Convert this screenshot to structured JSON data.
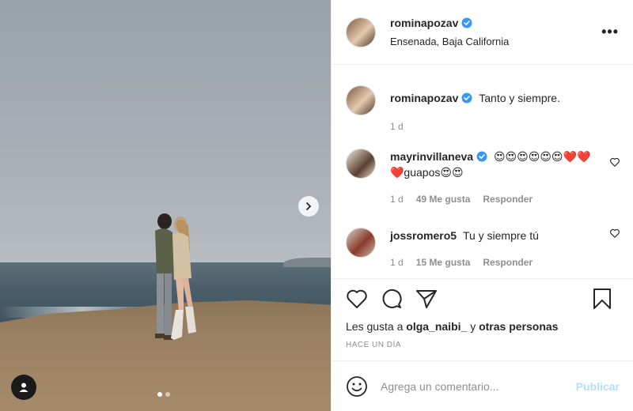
{
  "post": {
    "author": "rominapozav",
    "location": "Ensenada, Baja California",
    "more_icon": "more-horizontal-icon",
    "carousel_dots": 2,
    "carousel_active": 1
  },
  "caption": {
    "author": "rominapozav",
    "text": "Tanto y siempre.",
    "time": "1 d"
  },
  "comments": [
    {
      "author": "mayrinvillaneva",
      "text": "😍😍😍😍😍😍❤️❤️❤️guapos😍😍",
      "time": "1 d",
      "likes": "49 Me gusta",
      "reply": "Responder"
    },
    {
      "author": "jossromero5",
      "text": "Tu y siempre tú",
      "time": "1 d",
      "likes": "15 Me gusta",
      "reply": "Responder"
    }
  ],
  "likes": {
    "prefix": "Les gusta a",
    "user": "olga_naibi_",
    "joiner": "y",
    "others": "otras personas"
  },
  "timestamp": "HACE UN DÍA",
  "add_comment": {
    "placeholder": "Agrega un comentario...",
    "publish": "Publicar"
  },
  "colors": {
    "verified": "#3897f0",
    "publish_disabled": "#b2dffc",
    "secondary_text": "#8e8e8e"
  }
}
